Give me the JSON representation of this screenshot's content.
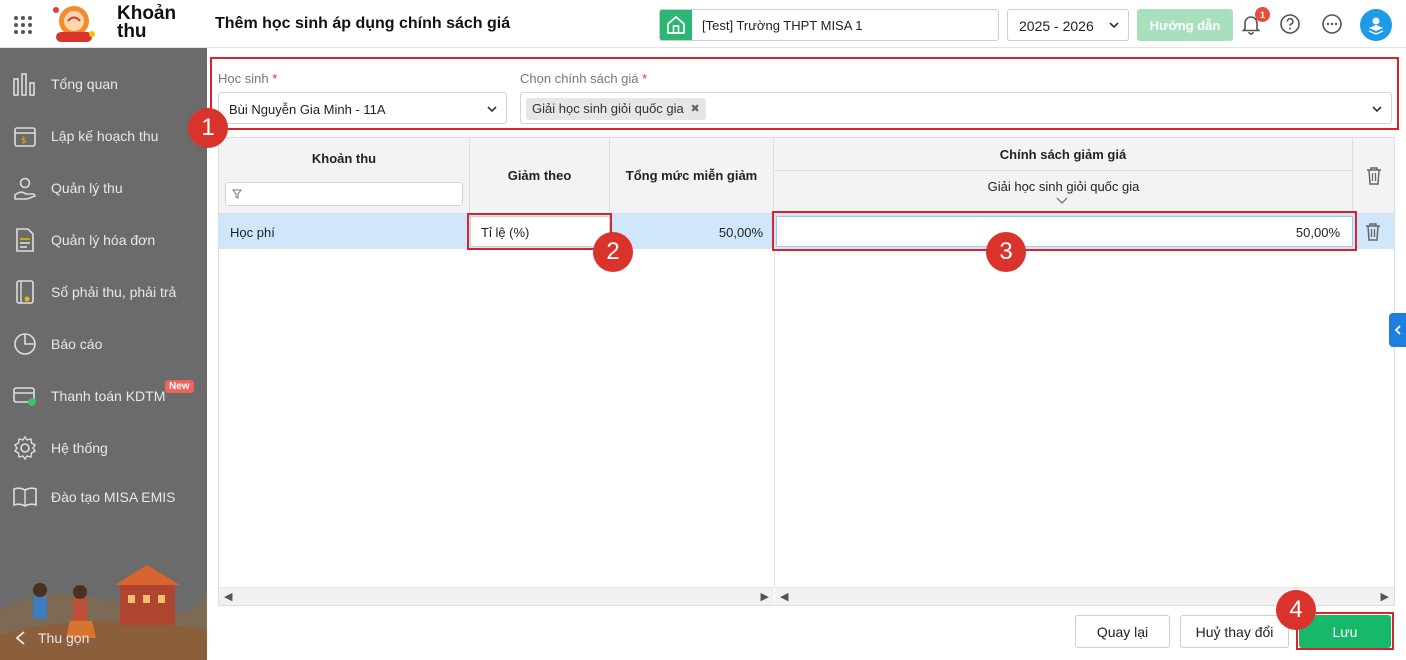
{
  "header": {
    "app_name_line1": "Khoản",
    "app_name_line2": "thu",
    "page_title": "Thêm học sinh áp dụng chính sách giá",
    "school": "[Test] Trường THPT MISA 1",
    "school_year": "2025 - 2026",
    "guide_label": "Hướng dẫn",
    "notification_count": "1"
  },
  "sidebar": {
    "items": [
      {
        "label": "Tổng quan",
        "icon": "bar-chart-icon"
      },
      {
        "label": "Lập kế hoạch thu",
        "icon": "calendar-money-icon"
      },
      {
        "label": "Quản lý thu",
        "icon": "hand-coin-icon"
      },
      {
        "label": "Quản lý hóa đơn",
        "icon": "invoice-icon"
      },
      {
        "label": "Sổ phải thu, phải trả",
        "icon": "ledger-book-icon"
      },
      {
        "label": "Báo cáo",
        "icon": "pie-chart-icon"
      },
      {
        "label": "Thanh toán KDTM",
        "icon": "card-payment-icon"
      },
      {
        "label": "Hệ thống",
        "icon": "gear-icon"
      },
      {
        "label": "Đào tạo MISA EMIS",
        "icon": "open-book-icon"
      }
    ],
    "new_badge": "New",
    "collapse_label": "Thu gọn"
  },
  "form": {
    "student_label": "Học sinh",
    "student_value": "Bùi Nguyễn Gia Minh - 11A",
    "policy_label": "Chọn chính sách giá",
    "policy_tag": "Giải học sinh giỏi quốc gia",
    "required_mark": "*"
  },
  "table": {
    "headers": {
      "fee": "Khoản thu",
      "reduce_by": "Giảm theo",
      "total_exempt": "Tổng mức miễn giảm",
      "discount_policy": "Chính sách giảm giá",
      "policy_column": "Giải học sinh giỏi quốc gia"
    },
    "rows": [
      {
        "fee": "Học phí",
        "reduce_by": "Tỉ lệ (%)",
        "total_exempt": "50,00%",
        "policy_value": "50,00%"
      }
    ]
  },
  "steps": [
    "1",
    "2",
    "3",
    "4"
  ],
  "footer": {
    "back_label": "Quay lại",
    "cancel_label": "Huỷ thay đổi",
    "save_label": "Lưu"
  },
  "colors": {
    "primary_green": "#18b86b",
    "annotation_red": "#d9232d",
    "selected_row": "#cfe6fb"
  }
}
